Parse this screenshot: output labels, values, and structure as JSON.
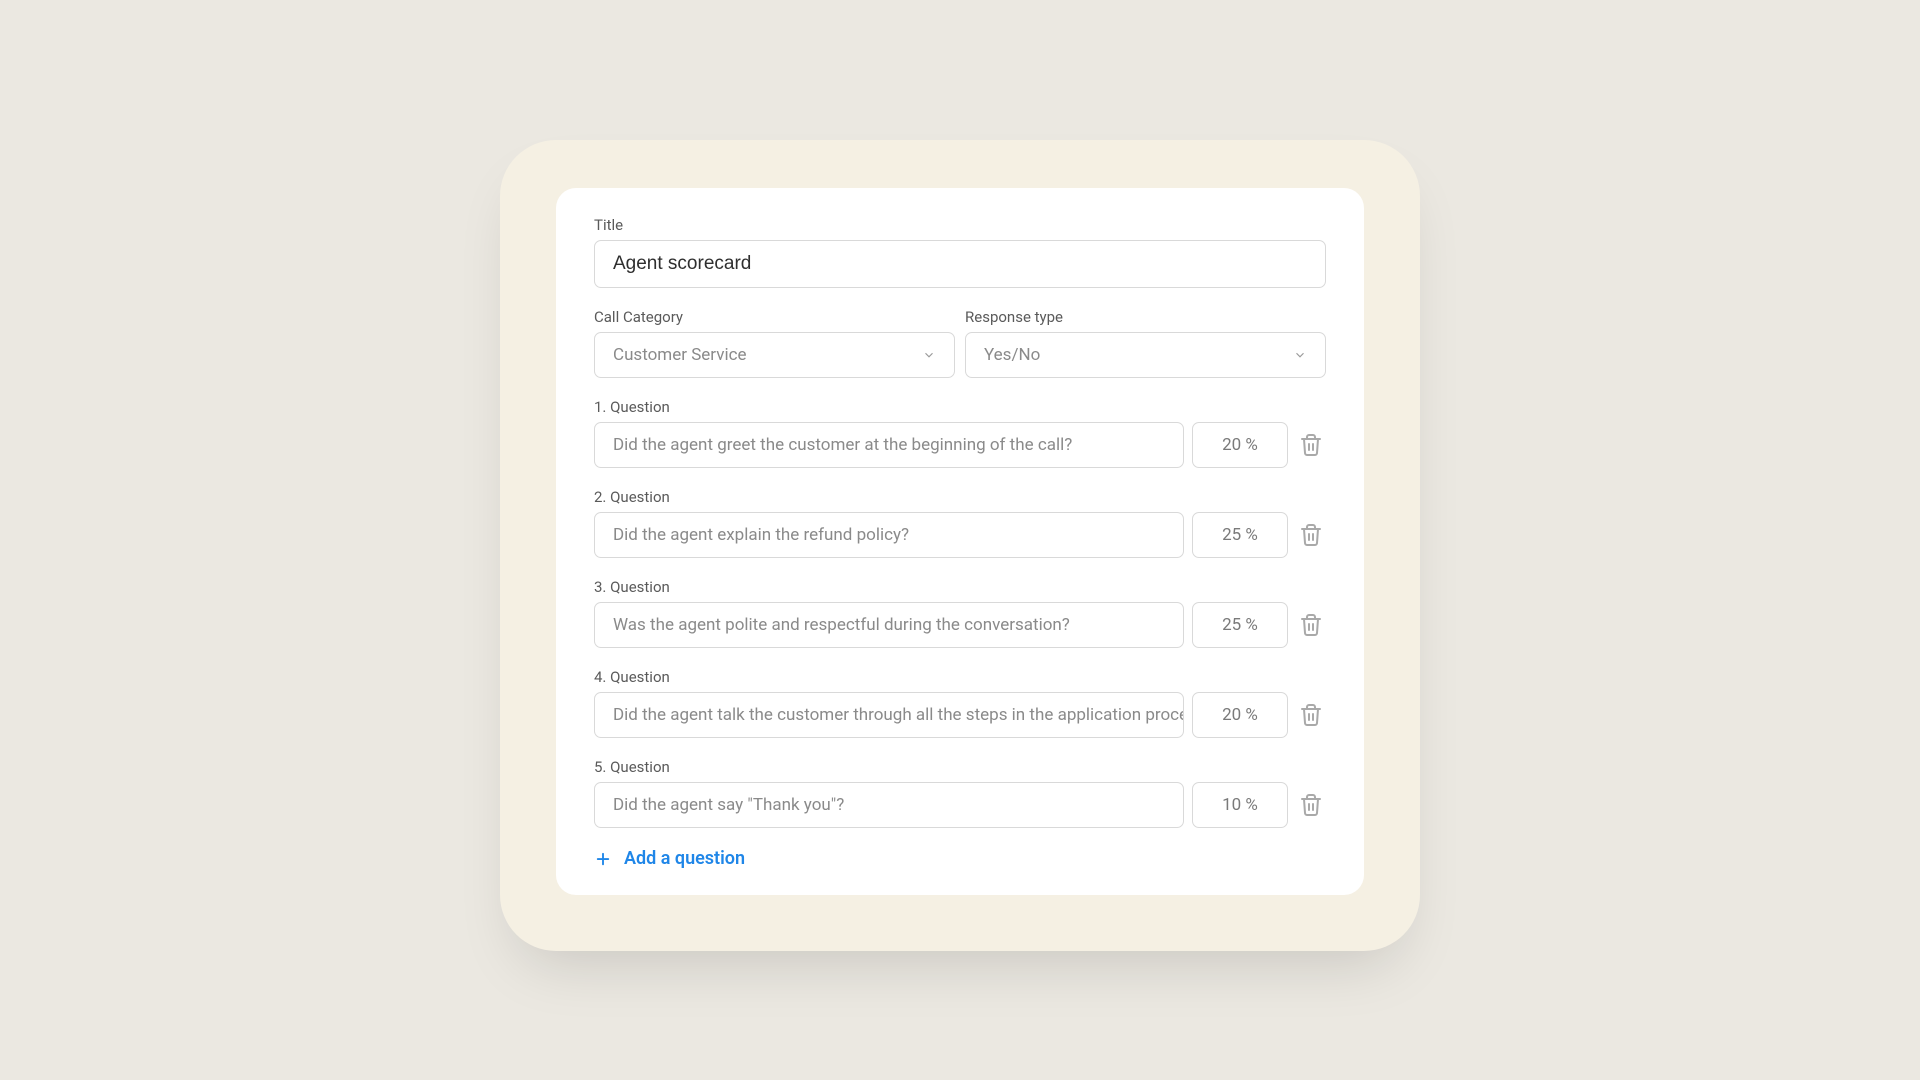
{
  "form": {
    "title_label": "Title",
    "title_value": "Agent scorecard",
    "call_category_label": "Call Category",
    "call_category_value": "Customer Service",
    "response_type_label": "Response type",
    "response_type_value": "Yes/No",
    "questions": [
      {
        "label": "1. Question",
        "text": "Did the agent greet the customer at the beginning of the call?",
        "weight": "20 %"
      },
      {
        "label": "2. Question",
        "text": "Did the agent explain the refund policy?",
        "weight": "25 %"
      },
      {
        "label": "3. Question",
        "text": "Was the agent polite and respectful during the conversation?",
        "weight": "25 %"
      },
      {
        "label": "4. Question",
        "text": "Did the agent talk the customer through all the steps in the application process?",
        "weight": "20 %"
      },
      {
        "label": "5. Question",
        "text": "Did the agent say \"Thank you\"?",
        "weight": "10 %"
      }
    ],
    "add_question_label": "Add a question"
  }
}
